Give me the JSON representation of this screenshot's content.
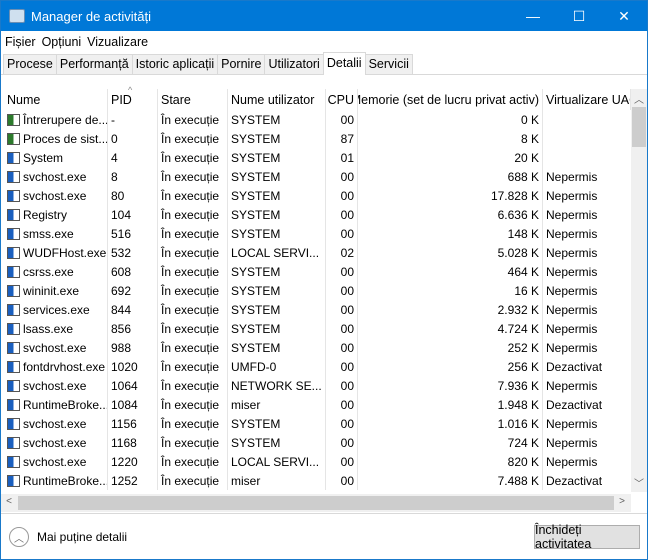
{
  "window": {
    "title": "Manager de activități",
    "minimize": "—",
    "maximize": "☐",
    "close": "✕"
  },
  "menu": [
    "Fișier",
    "Opțiuni",
    "Vizualizare"
  ],
  "tabs": [
    {
      "label": "Procese"
    },
    {
      "label": "Performanță"
    },
    {
      "label": "Istoric aplicații"
    },
    {
      "label": "Pornire"
    },
    {
      "label": "Utilizatori"
    },
    {
      "label": "Detalii",
      "active": true
    },
    {
      "label": "Servicii"
    }
  ],
  "columns": [
    "Nume",
    "PID",
    "Stare",
    "Nume utilizator",
    "CPU",
    "Memorie (set de lucru privat activ)",
    "Virtualizare UAC"
  ],
  "sort": {
    "column": "PID",
    "direction": "ascending"
  },
  "rows": [
    [
      "Întrerupere de...",
      "-",
      "În execuție",
      "SYSTEM",
      "00",
      "0 K",
      ""
    ],
    [
      "Proces de sist...",
      "0",
      "În execuție",
      "SYSTEM",
      "87",
      "8 K",
      ""
    ],
    [
      "System",
      "4",
      "În execuție",
      "SYSTEM",
      "01",
      "20 K",
      ""
    ],
    [
      "svchost.exe",
      "8",
      "În execuție",
      "SYSTEM",
      "00",
      "688 K",
      "Nepermis"
    ],
    [
      "svchost.exe",
      "80",
      "În execuție",
      "SYSTEM",
      "00",
      "17.828 K",
      "Nepermis"
    ],
    [
      "Registry",
      "104",
      "În execuție",
      "SYSTEM",
      "00",
      "6.636 K",
      "Nepermis"
    ],
    [
      "smss.exe",
      "516",
      "În execuție",
      "SYSTEM",
      "00",
      "148 K",
      "Nepermis"
    ],
    [
      "WUDFHost.exe",
      "532",
      "În execuție",
      "LOCAL SERVI...",
      "02",
      "5.028 K",
      "Nepermis"
    ],
    [
      "csrss.exe",
      "608",
      "În execuție",
      "SYSTEM",
      "00",
      "464 K",
      "Nepermis"
    ],
    [
      "wininit.exe",
      "692",
      "În execuție",
      "SYSTEM",
      "00",
      "16 K",
      "Nepermis"
    ],
    [
      "services.exe",
      "844",
      "În execuție",
      "SYSTEM",
      "00",
      "2.932 K",
      "Nepermis"
    ],
    [
      "lsass.exe",
      "856",
      "În execuție",
      "SYSTEM",
      "00",
      "4.724 K",
      "Nepermis"
    ],
    [
      "svchost.exe",
      "988",
      "În execuție",
      "SYSTEM",
      "00",
      "252 K",
      "Nepermis"
    ],
    [
      "fontdrvhost.exe",
      "1020",
      "În execuție",
      "UMFD-0",
      "00",
      "256 K",
      "Dezactivat"
    ],
    [
      "svchost.exe",
      "1064",
      "În execuție",
      "NETWORK SE...",
      "00",
      "7.936 K",
      "Nepermis"
    ],
    [
      "RuntimeBroke...",
      "1084",
      "În execuție",
      "miser",
      "00",
      "1.948 K",
      "Dezactivat"
    ],
    [
      "svchost.exe",
      "1156",
      "În execuție",
      "SYSTEM",
      "00",
      "1.016 K",
      "Nepermis"
    ],
    [
      "svchost.exe",
      "1168",
      "În execuție",
      "SYSTEM",
      "00",
      "724 K",
      "Nepermis"
    ],
    [
      "svchost.exe",
      "1220",
      "În execuție",
      "LOCAL SERVI...",
      "00",
      "820 K",
      "Nepermis"
    ],
    [
      "RuntimeBroke...",
      "1252",
      "În execuție",
      "miser",
      "00",
      "7.488 K",
      "Dezactivat"
    ]
  ],
  "footer": {
    "fewer_details": "Mai puține detalii",
    "end_task": "Închideți activitatea"
  }
}
